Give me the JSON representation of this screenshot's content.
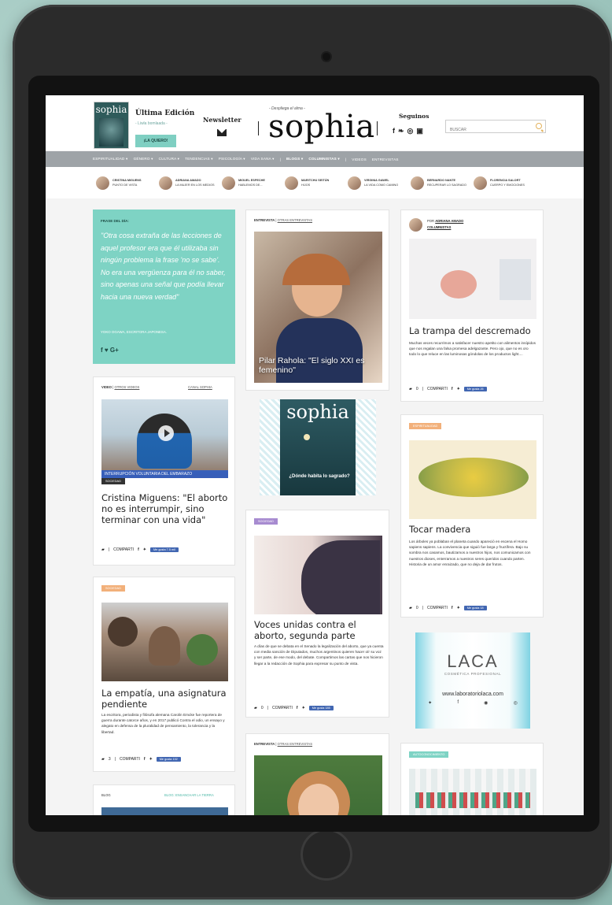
{
  "header": {
    "last_edition_title": "Última Edición",
    "last_edition_sub": "- Liwla bomlaada -",
    "cta": "¡LA QUIERO!",
    "magazine_mini_title": "sophia",
    "newsletter": "Newsletter",
    "logo_tagline": "- Despliega el alma -",
    "logo": "sophia",
    "follow": "Seguinos",
    "social": [
      "f",
      "❧",
      "◎",
      "▣"
    ],
    "search_placeholder": "BUSCAR"
  },
  "nav": [
    {
      "label": "ESPIRITUALIDAD ▾",
      "bold": false
    },
    {
      "label": "GÉNERO ▾",
      "bold": false
    },
    {
      "label": "CULTURA ▾",
      "bold": false
    },
    {
      "label": "TENDENCIAS ▾",
      "bold": false
    },
    {
      "label": "PSICOLOGÍA ▾",
      "bold": false
    },
    {
      "label": "VIDA SANA ▾",
      "bold": false
    },
    {
      "label": "|",
      "bold": false
    },
    {
      "label": "BLOGS ▾",
      "bold": true
    },
    {
      "label": "COLUMNISTAS ▾",
      "bold": true
    },
    {
      "label": "|",
      "bold": false
    },
    {
      "label": "VIDEOS",
      "bold": false
    },
    {
      "label": "ENTREVISTAS",
      "bold": false
    }
  ],
  "columnists": [
    {
      "name": "CRISTINA MIGUENS",
      "column": "PUNTO DE VISTA"
    },
    {
      "name": "ADRIANA AMADO",
      "column": "LA MUJER EN LOS MEDIOS"
    },
    {
      "name": "MIGUEL ESPECHE",
      "column": "HABLEMOS DE..."
    },
    {
      "name": "MARITCHU SEITÚN",
      "column": "HIJOS"
    },
    {
      "name": "VIRGINIA GAWEL",
      "column": "LA VIDA COMO CAMINO"
    },
    {
      "name": "BERNARDO NANTE",
      "column": "RECUPERAR LO SAGRADO"
    },
    {
      "name": "FLORENCIA SALORT",
      "column": "CUERPO Y EMOCIONES"
    }
  ],
  "frase": {
    "label": "FRASE DEL DÍA:",
    "quote": "\"Otra cosa extraña de las lecciones de aquel profesor era que él utilizaba sin ningún problema la frase 'no se sabe'. No era una vergüenza para él no saber, sino apenas una señal que podía llevar hacia una nueva verdad\"",
    "author": "YOKO OGAWA, ESCRITORA JAPONESA.",
    "share": "f  ♥  G+"
  },
  "video": {
    "tag": "VIDEO",
    "tag_link": "OTROS VIDEOS",
    "channel": "CANAL SOPHIA",
    "banner": "INTERRUPCIÓN VOLUNTARIA DEL EMBARAZO",
    "category": "SOCIEDAD",
    "title": "Cristina Miguens: \"El aborto no es interrumpir, sino terminar con una vida\"",
    "share": "COMPARTI",
    "likes": "Me gusta 7.5 mil"
  },
  "empatia": {
    "category": "SOCIEDAD",
    "title": "La empatía, una asignatura pendiente",
    "body": "La escritora, periodista y filósofa alemana Carolin Emcke fue reportera de guerra durante catorce años, y en 2017 publicó Contra el odio, un ensayo y alegato en defensa de la pluralidad de pensamiento, la tolerancia y la libertad.",
    "comments": "3",
    "share": "COMPARTI",
    "likes": "Me gusta 132"
  },
  "blog_strip": {
    "tag": "BLOG",
    "link": "BLOG: ENSANCHAR LA TIERRA"
  },
  "interview": {
    "tag": "ENTREVISTA",
    "tag_link": "OTRAS ENTREVISTAS",
    "caption": "Pilar Rahola: \"El siglo XXI es femenino\""
  },
  "cover_ad": {
    "title": "sophia",
    "subtitle": "¿Dónde habita lo sagrado?"
  },
  "voces": {
    "category": "SOCIEDAD",
    "title": "Voces unidas contra el aborto, segunda parte",
    "body": "A días de que se debata en el Senado la legalización del aborto, que ya cuenta con media sanción de Diputados, muchos argentinos quieren hacer oír su voz y ser parte, de ese modo, del debate. Compartimos las cartas que nos hicieron llegar a la redacción de Sophia para expresar su punto de vista.",
    "comments": "0",
    "share": "COMPARTI",
    "likes": "Me gusta 185"
  },
  "interview2": {
    "tag": "ENTREVISTA",
    "tag_link": "OTRAS ENTREVISTAS"
  },
  "trampa": {
    "by": "POR",
    "author": "ADRIANA AMADO",
    "section": "COLUMNISTAS",
    "title": "La trampa del descremado",
    "body": "Muchas veces recurrimos a satisfacer nuestro apetito con alimentos insípidos que nos regalan una falsa promesa adelgazante. Pero ojo, que no es oro todo lo que reluce en las luminosas góndolas de los productos light....",
    "comments": "0",
    "share": "COMPARTI",
    "likes": "Me gusta 26"
  },
  "madera": {
    "category": "ESPIRITUALIDAD",
    "title": "Tocar madera",
    "body": "Los árboles ya poblaban el planeta cuando apareció en escena el Homo sapiens sapiens. La convivencia que siguió fue larga y fructífera. Bajo su sombra nos casamos, bautizamos a nuestros hijos, nos comunicamos con nuestros dioses, enterramos a nuestros seres queridos cuando parten. Historia de un amor enraizado, que no deja de dar frutos.",
    "comments": "0",
    "share": "COMPARTI",
    "likes": "Me gusta 18"
  },
  "laca": {
    "brand": "LACA",
    "sub": "COSMÉTICA PROFESIONAL",
    "url": "www.laboratoriolaca.com"
  },
  "last": {
    "category": "AUTOCONOCIMIENTO"
  },
  "colors": {
    "teal": "#7ed3c4",
    "orange": "#f2b07a",
    "purple": "#a78bd0",
    "fb": "#4267b2",
    "nav": "#9ea3a7"
  }
}
